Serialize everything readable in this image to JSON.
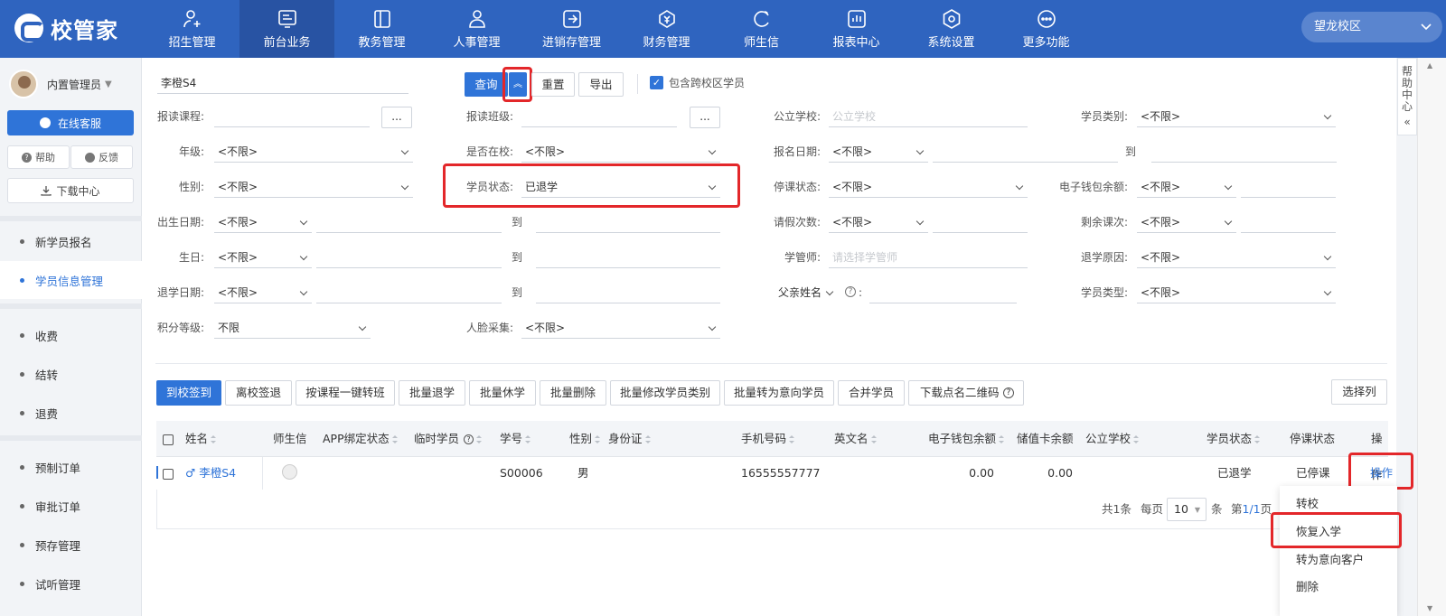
{
  "app": {
    "brand": "校管家",
    "campus": "望龙校区"
  },
  "nav": [
    {
      "label": "招生管理",
      "icon": "user-plus-icon"
    },
    {
      "label": "前台业务",
      "icon": "monitor-icon"
    },
    {
      "label": "教务管理",
      "icon": "book-icon"
    },
    {
      "label": "人事管理",
      "icon": "person-icon"
    },
    {
      "label": "进销存管理",
      "icon": "inventory-icon"
    },
    {
      "label": "财务管理",
      "icon": "money-bag-icon"
    },
    {
      "label": "师生信",
      "icon": "chat-icon"
    },
    {
      "label": "报表中心",
      "icon": "report-icon"
    },
    {
      "label": "系统设置",
      "icon": "settings-icon"
    },
    {
      "label": "更多功能",
      "icon": "more-icon"
    }
  ],
  "sidebar": {
    "user": "内置管理员",
    "service": "在线客服",
    "help": "帮助",
    "feedback": "反馈",
    "download": "下载中心",
    "items": [
      "新学员报名",
      "学员信息管理",
      "收费",
      "结转",
      "退费",
      "预制订单",
      "审批订单",
      "预存管理",
      "试听管理"
    ]
  },
  "search": {
    "value": "李橙S4",
    "query": "查询",
    "reset": "重置",
    "export": "导出",
    "cross_campus": "包含跨校区学员"
  },
  "filters": {
    "course_label": "报读课程:",
    "class_label": "报读班级:",
    "dots": "...",
    "school_label": "公立学校:",
    "school_ph": "公立学校",
    "type_label": "学员类别:",
    "unlimited": "<不限>",
    "grade_label": "年级:",
    "inschool_label": "是否在校:",
    "regdate_label": "报名日期:",
    "to": "到",
    "gender_label": "性别:",
    "status_label": "学员状态:",
    "status_value": "已退学",
    "suspend_label": "停课状态:",
    "wallet_label": "电子钱包余额:",
    "birthdate_label": "出生日期:",
    "leave_label": "请假次数:",
    "remain_label": "剩余课次:",
    "birthday_label": "生日:",
    "manager_label": "学管师:",
    "manager_ph": "请选择学管师",
    "drop_reason_label": "退学原因:",
    "dropdate_label": "退学日期:",
    "father_label": "父亲姓名",
    "colon": ":",
    "stype_label": "学员类型:",
    "points_label": "积分等级:",
    "points_value": "不限",
    "face_label": "人脸采集:"
  },
  "actions": [
    "到校签到",
    "离校签退",
    "按课程一键转班",
    "批量退学",
    "批量休学",
    "批量删除",
    "批量修改学员类别",
    "批量转为意向学员",
    "合并学员",
    "下载点名二维码"
  ],
  "choose_columns": "选择列",
  "table": {
    "headers": [
      "姓名",
      "师生信",
      "APP绑定状态",
      "临时学员",
      "学号",
      "性别",
      "身份证",
      "手机号码",
      "英文名",
      "电子钱包余额",
      "储值卡余额",
      "公立学校",
      "学员状态",
      "停课状态",
      "操作"
    ],
    "row": {
      "gender_icon": "♂",
      "name": "李橙S4",
      "sid": "S00006",
      "sex": "男",
      "phone": "16555557777",
      "wallet": "0.00",
      "card": "0.00",
      "status": "已退学",
      "suspend": "已停课",
      "op": "操作"
    }
  },
  "pager": {
    "total": "共1条",
    "per": "每页",
    "size": "10",
    "unit": "条",
    "page_prefix": "第",
    "page_num": "1/1",
    "page_suffix": "页"
  },
  "menu": [
    "转校",
    "恢复入学",
    "转为意向客户",
    "删除"
  ],
  "help_center": "帮助中心"
}
